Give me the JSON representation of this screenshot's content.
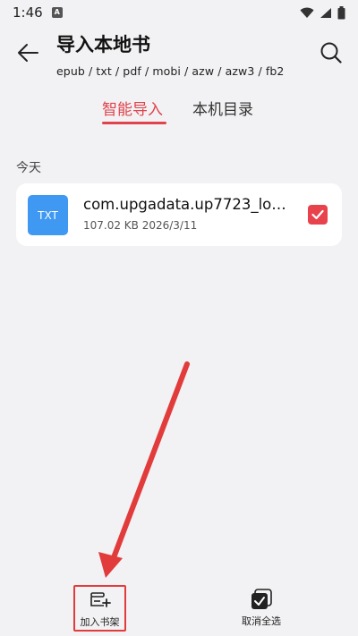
{
  "status_bar": {
    "time": "1:46",
    "app_icon_glyph": "A",
    "icons": [
      "wifi-icon",
      "signal-icon",
      "battery-icon"
    ]
  },
  "header": {
    "title": "导入本地书",
    "formats": "epub / txt / pdf / mobi / azw / azw3 / fb2",
    "icons": {
      "back": "arrow-left-icon",
      "search": "search-icon"
    }
  },
  "tabs": [
    {
      "label": "智能导入",
      "active": true
    },
    {
      "label": "本机目录",
      "active": false
    }
  ],
  "section": {
    "label": "今天"
  },
  "files": [
    {
      "type_label": "TXT",
      "name": "com.upgadata.up7723_log...",
      "meta": "107.02 KB  2026/3/11",
      "checked": true
    }
  ],
  "bottom_bar": {
    "add_to_shelf": "加入书架",
    "deselect_all": "取消全选"
  },
  "colors": {
    "accent": "#e0434b",
    "background": "#f2f2f4",
    "file_icon": "#3f98f2",
    "annotation": "#e23b3b"
  }
}
